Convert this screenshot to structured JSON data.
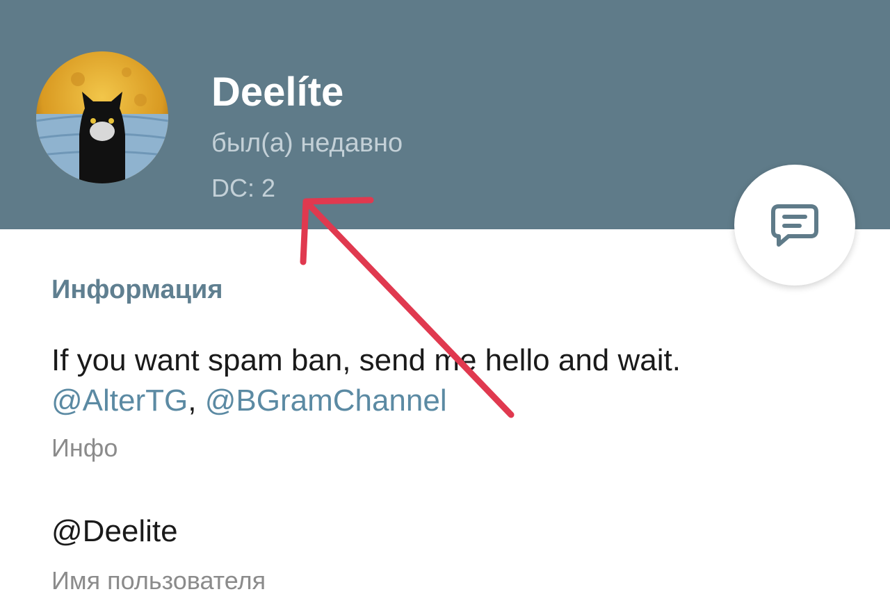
{
  "profile": {
    "name": "Deelíte",
    "status": "был(а) недавно",
    "dc": "DC: 2"
  },
  "info": {
    "section_title": "Информация",
    "bio_text": "If you want spam ban, send me hello and wait.",
    "bio_links": [
      "@AlterTG",
      "@BGramChannel"
    ],
    "bio_link_separator": ", ",
    "bio_label": "Инфо",
    "username": "@Deelite",
    "username_label": "Имя пользователя"
  },
  "icons": {
    "fab": "message-icon",
    "annotation": "red-arrow"
  },
  "colors": {
    "header_bg": "#5f7b89",
    "link": "#5b8aa3",
    "section_title": "#5f7f90",
    "annotation_arrow": "#e0394f"
  }
}
